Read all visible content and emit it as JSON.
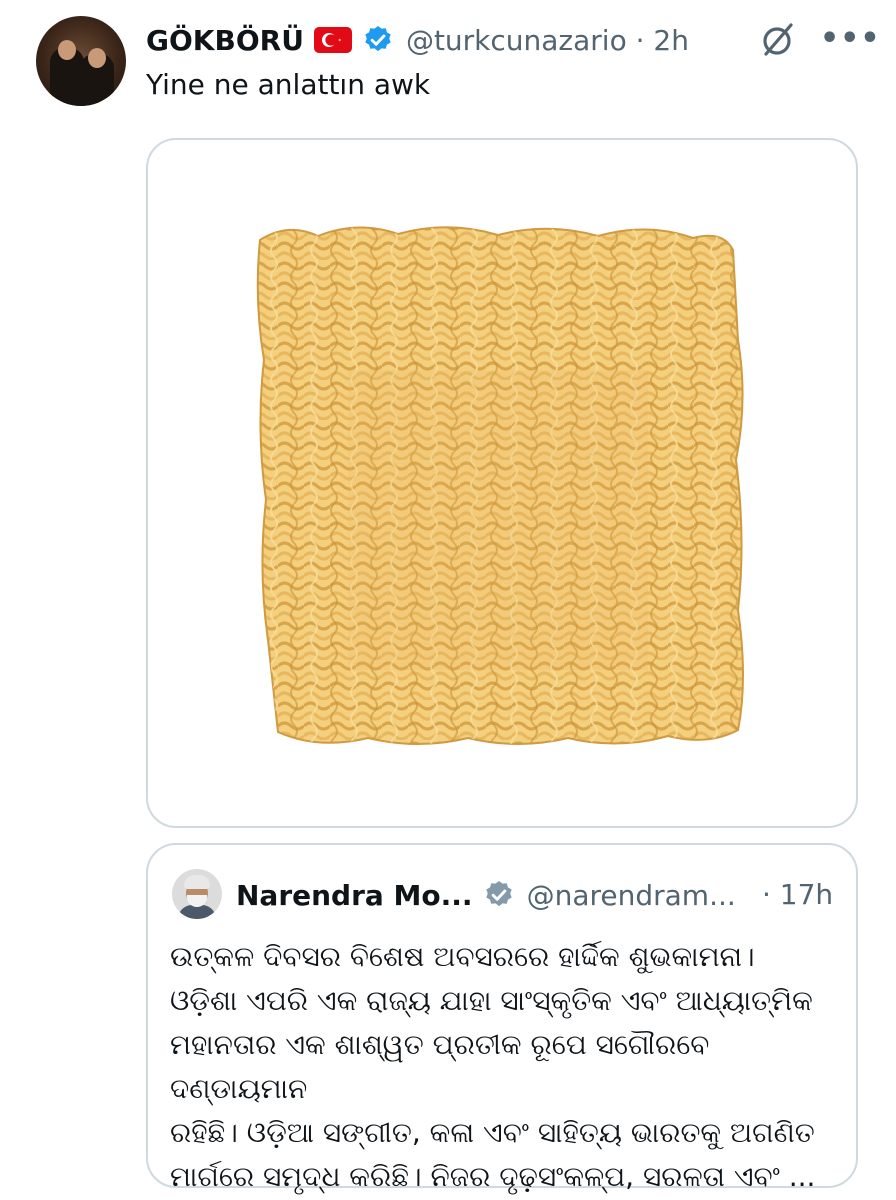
{
  "tweet": {
    "author_name": "GÖKBÖRÜ",
    "handle": "@turkcunazario",
    "separator": " · ",
    "time": "2h",
    "text": "Yine ne anlattın awk",
    "flag_icon": "turkey-flag",
    "verified_icon": "verified-badge",
    "verified_color": "#1d9bf0"
  },
  "media": {
    "image_icon": "instant-noodle-block",
    "noodle_color": "#f2c56b"
  },
  "quote": {
    "author_name": "Narendra Mo...",
    "handle": "@narendram...",
    "time": "· 17h",
    "verified_icon": "verified-badge-gray",
    "verified_color": "#829aab",
    "lines": [
      "ଉତ୍କଳ ଦିବସର ବିଶେଷ ଅବସରରେ ହାର୍ଦ୍ଦିକ ଶୁଭକାମନା।",
      "ଓଡ଼ିଶା ଏପରି ଏକ ରାଜ୍ୟ ଯାହା ସାଂସ୍କୃତିକ ଏବଂ ଆଧ୍ୟାତ୍ମିକ",
      "ମହାନତାର ଏକ ଶାଶ୍ୱତ ପ୍ରତୀକ ରୂପେ ସଗୌରବେ ଦଣ୍ଡାୟମାନ",
      "ରହିଛି। ଓଡ଼ିଆ ସଙ୍ଗୀତ, କଳା ଏବଂ ସାହିତ୍ୟ ଭାରତକୁ ଅଗଣିତ",
      "ମାର୍ଗରେ ସମୃଦ୍ଧ କରିଛି। ନିଜର ଦୃଢ଼ସଂକଳ୍ପ, ସରଳତା ଏବଂ ..."
    ]
  },
  "actions": {
    "grok_icon": "grok-icon",
    "more_icon": "more-options-icon",
    "more_label": "•••"
  }
}
